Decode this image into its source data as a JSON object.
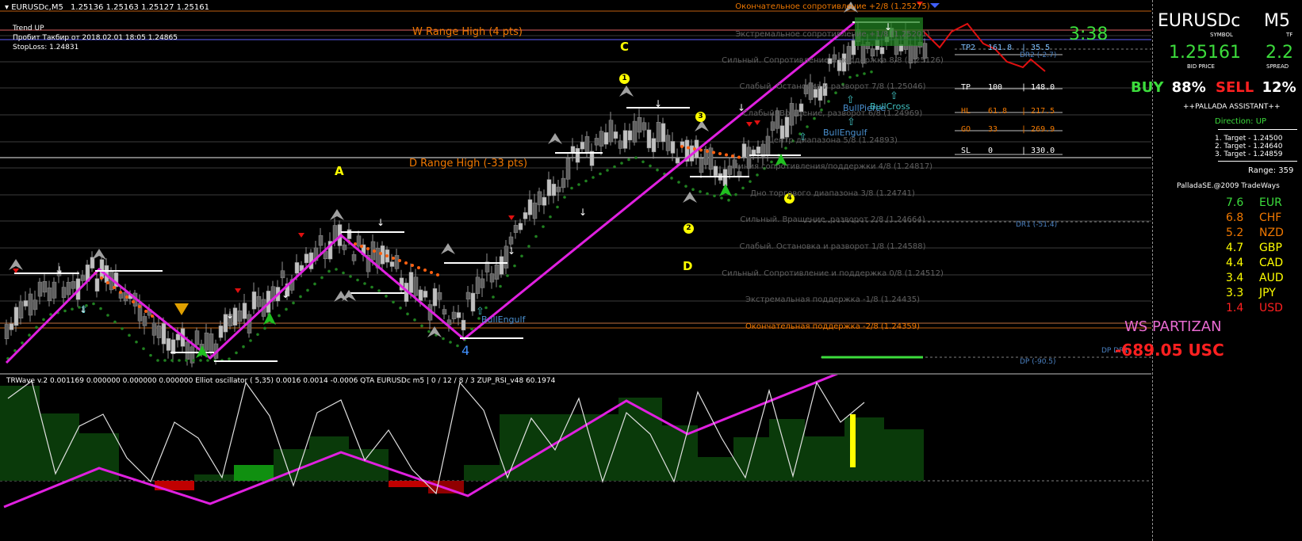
{
  "window": {
    "title": "EURUSDc,M5",
    "ohlc": "1.25136 1.25163 1.25127 1.25161"
  },
  "info_lines": [
    "Trend UP",
    "Пробит Такбир от 2018.02.01 18:05 1.24865",
    "StopLoss: 1.24831"
  ],
  "range_labels": {
    "w_range": "W Range High (4 pts)",
    "d_range": "D Range High (-33 pts)"
  },
  "wave_labels": [
    "A",
    "C",
    "D",
    "4"
  ],
  "small_markers": [
    "1",
    "2",
    "3",
    "4"
  ],
  "murrey_levels": [
    {
      "label": "Окончательное сопротивление +2/8  (1.25275)",
      "color": "#f07800"
    },
    {
      "label": "Экстремальное сопротивление +1/8  (1.25201)",
      "color": "#606060"
    },
    {
      "label": "Сильный. Сопротивление и поддержка 8/8  (1.25126)",
      "color": "#606060"
    },
    {
      "label": "Слабый. Остановка и разворот 7/8  (1.25046)",
      "color": "#606060"
    },
    {
      "label": "Слабый. Вращение, разворот 6/8  (1.24969)",
      "color": "#606060"
    },
    {
      "label": "Центр диапазона 5/8  (1.24893)",
      "color": "#606060"
    },
    {
      "label": "Линия сопротивления/поддержки 4/8  (1.24817)",
      "color": "#606060"
    },
    {
      "label": "Дно торгового диапазона 3/8  (1.24741)",
      "color": "#606060"
    },
    {
      "label": "Сильный. Вращение, разворот 2/8  (1.24664)",
      "color": "#606060"
    },
    {
      "label": "Слабый. Остановка и разворот 1/8  (1.24588)",
      "color": "#606060"
    },
    {
      "label": "Сильный. Сопротивление и поддержка 0/8  (1.24512)",
      "color": "#606060"
    },
    {
      "label": "Экстремальная поддержка -1/8  (1.24435)",
      "color": "#606060"
    },
    {
      "label": "Окончательная поддержка -2/8  (1.24359)",
      "color": "#f07800"
    }
  ],
  "pattern_labels": [
    "BullEngulf",
    "BullEngulf",
    "BullPierce",
    "BullCross"
  ],
  "dr_labels": [
    "DR2 (-2.7)",
    "DR1 (-51.4)",
    "DP (-90.5)"
  ],
  "tp_table": [
    {
      "name": "TP2",
      "pct": "161.8",
      "pts": "35.5",
      "color": "#7fc0ff"
    },
    {
      "name": "TP",
      "pct": "100",
      "pts": "148.0",
      "color": "#ffffff"
    },
    {
      "name": "HL",
      "pct": "61.8",
      "pts": "217.5",
      "color": "#f07800"
    },
    {
      "name": "GO",
      "pct": "33",
      "pts": "269.9",
      "color": "#f07800"
    },
    {
      "name": "SL",
      "pct": "0",
      "pts": "330.0",
      "color": "#ffffff"
    }
  ],
  "countdown": "3:38",
  "subwindow_header": "TRWave v.2 0.001169 0.000000 0.000000 0.000000  Elliot oscillator ( 5,35) 0.0016 0.0014 -0.0006  QTA EURUSDc m5 | 0 / 12 / 8 / 3  ZUP_RSI_v48 60.1974",
  "panel": {
    "symbol": "EURUSDc",
    "symbol_caption": "SYMBOL",
    "tf": "M5",
    "tf_caption": "TF",
    "price": "1.25161",
    "price_caption": "BID PRICE",
    "spread": "2.2",
    "spread_caption": "SPREAD",
    "buy_label": "BUY",
    "buy_pct": "88%",
    "sell_label": "SELL",
    "sell_pct": "12%",
    "assistant": "++PALLADA ASSISTANT++",
    "direction": "Direction: UP",
    "targets": [
      "1. Target - 1.24500",
      "2. Target - 1.24640",
      "3. Target - 1.24859"
    ],
    "range": "Range: 359",
    "copyright": "PalladaSE.@2009 TradeWays",
    "currencies": [
      {
        "value": "7.6",
        "name": "EUR",
        "color": "#3cdc3c"
      },
      {
        "value": "6.8",
        "name": "CHF",
        "color": "#f07800"
      },
      {
        "value": "5.2",
        "name": "NZD",
        "color": "#f07800"
      },
      {
        "value": "4.7",
        "name": "GBP",
        "color": "#ffff00"
      },
      {
        "value": "4.4",
        "name": "CAD",
        "color": "#ffff00"
      },
      {
        "value": "3.4",
        "name": "AUD",
        "color": "#ffff00"
      },
      {
        "value": "3.3",
        "name": "JPY",
        "color": "#ffff00"
      },
      {
        "value": "1.4",
        "name": "USD",
        "color": "#ff2020"
      }
    ],
    "account_name": "WS PARTIZAN",
    "pnl": "-689.05 USC",
    "dp_overlay": "DP DR1"
  },
  "colors": {
    "bull_candle": "#c0c0c0",
    "bear_candle": "#606060",
    "zigzag": "#e020e0",
    "signal_red": "#e01010",
    "green_dots": "#208020",
    "orange_dots": "#ff6010",
    "osc_pos": "#0a3a0a",
    "osc_neg": "#c00000",
    "yellow": "#ffff00",
    "green_text": "#3cdc3c"
  }
}
